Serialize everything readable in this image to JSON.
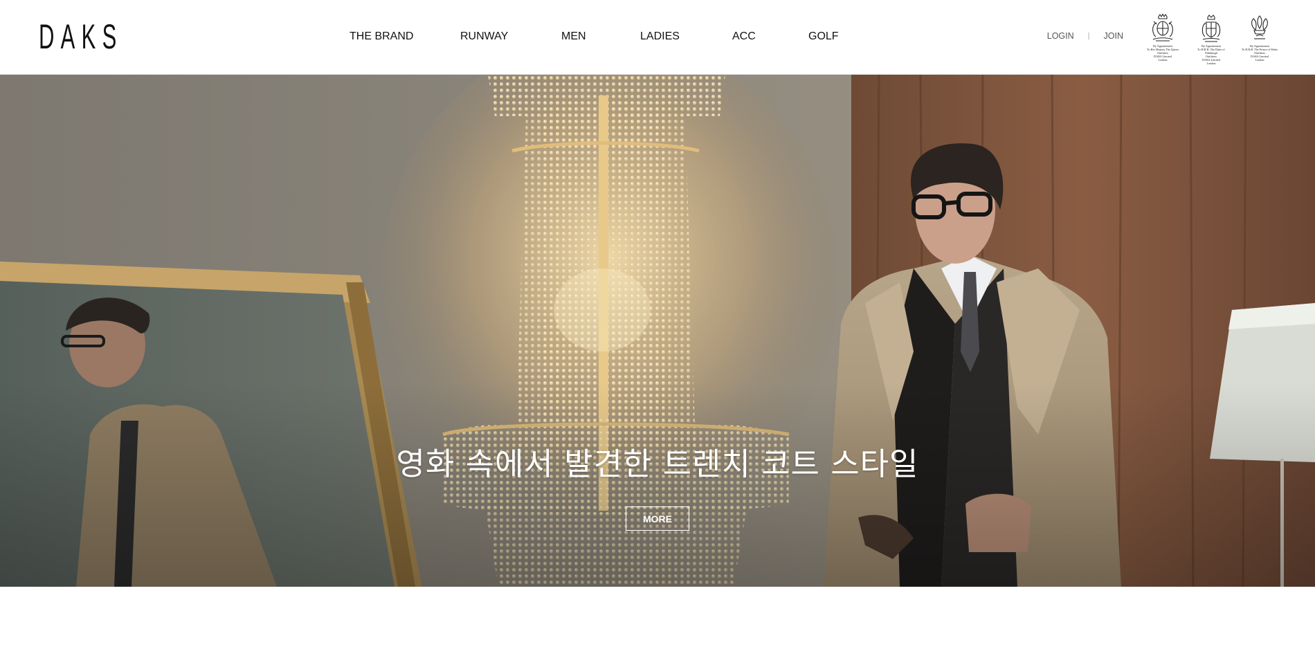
{
  "brand": {
    "logo_text": "DAKS"
  },
  "nav": {
    "items": [
      {
        "label": "THE BRAND"
      },
      {
        "label": "RUNWAY"
      },
      {
        "label": "MEN"
      },
      {
        "label": "LADIES"
      },
      {
        "label": "ACC"
      },
      {
        "label": "GOLF"
      }
    ]
  },
  "account": {
    "login_label": "LOGIN",
    "separator": "|",
    "join_label": "JOIN"
  },
  "royal_warrants": [
    {
      "icon": "royal-crest-icon",
      "caption": "By Appointment\nTo Her Majesty The Queen\nOutfitters\nDAKS Limited\nLondon"
    },
    {
      "icon": "royal-crest-icon",
      "caption": "By Appointment\nTo H.R.H. The Duke of Edinburgh\nOutfitters\nDAKS Limited\nLondon"
    },
    {
      "icon": "prince-of-wales-feathers-icon",
      "caption": "By Appointment\nTo H.R.H. The Prince of Wales\nOutfitters\nDAKS Limited\nLondon"
    }
  ],
  "hero": {
    "headline": "영화 속에서 발견한 트렌치 코트 스타일",
    "cta_label": "MORE"
  },
  "colors": {
    "header_bg": "#ffffff",
    "text": "#111111",
    "hero_text": "#ffffff"
  }
}
